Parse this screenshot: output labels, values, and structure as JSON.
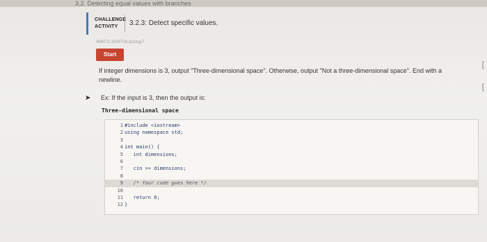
{
  "top_strip": "3.2. Detecting equal values with branches",
  "header": {
    "activity_label_1": "CHALLENGE",
    "activity_label_2": "ACTIVITY",
    "title": "3.2.3: Detect specific values."
  },
  "identifier": "494072.3204716.qx3zqy7",
  "start_button": "Start",
  "instruction": "If integer dimensions is 3, output \"Three-dimensional space\". Otherwise, output \"Not a three-dimensional space\". End with a newline.",
  "example": "Ex: If the input is 3, then the output is:",
  "example_output": "Three-dimensional space",
  "code_lines": [
    {
      "num": "1",
      "text": "#include <iostream>"
    },
    {
      "num": "2",
      "text": "using namespace std;"
    },
    {
      "num": "3",
      "text": ""
    },
    {
      "num": "4",
      "text": "int main() {"
    },
    {
      "num": "5",
      "text": "   int dimensions;"
    },
    {
      "num": "6",
      "text": ""
    },
    {
      "num": "7",
      "text": "   cin >> dimensions;"
    },
    {
      "num": "8",
      "text": ""
    },
    {
      "num": "9",
      "text": "   /* Your code goes here */"
    },
    {
      "num": "10",
      "text": ""
    },
    {
      "num": "11",
      "text": "   return 0;"
    },
    {
      "num": "12",
      "text": "}"
    }
  ]
}
